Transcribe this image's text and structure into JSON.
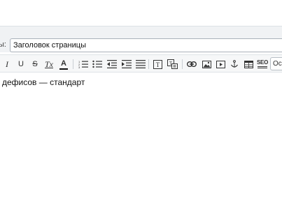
{
  "title_field": {
    "label": "ы:",
    "value": "Заголовок страницы"
  },
  "toolbar": {
    "buttons": {
      "italic": "I",
      "underline": "U",
      "strikethrough": "S",
      "clear_format": "Tx",
      "font_color": "A",
      "seo": "SEO"
    },
    "format_select": "Осн",
    "accent_color": "#c0392b"
  },
  "content": {
    "text": "дефисов — стандарт"
  }
}
